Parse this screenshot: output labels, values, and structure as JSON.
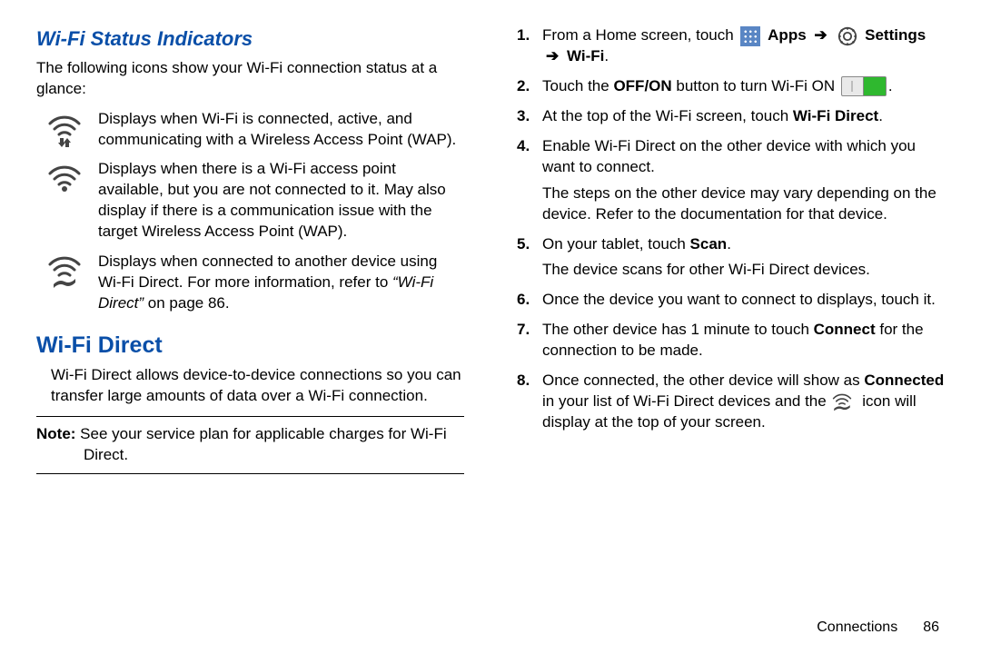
{
  "left": {
    "h_status": "Wi-Fi Status Indicators",
    "status_intro": "The following icons show your Wi-Fi connection status at a glance:",
    "icon1": "Displays when Wi-Fi is connected, active, and communicating with a Wireless Access Point (WAP).",
    "icon2": "Displays when there is a Wi-Fi access point available, but you are not connected to it. May also display if there is a communication issue with the target Wireless Access Point (WAP).",
    "icon3_a": "Displays when connected to another device using Wi-Fi Direct. For more information, refer to ",
    "icon3_ref": "“Wi-Fi Direct”",
    "icon3_b": " on page 86.",
    "h_direct": "Wi-Fi Direct",
    "direct_intro": "Wi-Fi Direct allows device-to-device connections so you can transfer large amounts of data over a Wi-Fi connection.",
    "note_label": "Note:",
    "note_text": " See your service plan for applicable charges for Wi-Fi Direct."
  },
  "right": {
    "s1_a": "From a Home screen, touch ",
    "s1_apps": " Apps ",
    "s1_settings": " Settings ",
    "s1_b": " Wi-Fi",
    "s2_a": "Touch the ",
    "s2_offon": "OFF/ON",
    "s2_b": " button to turn Wi-Fi ON ",
    "s3_a": "At the top of the Wi-Fi screen, touch ",
    "s3_b": "Wi-Fi Direct",
    "s4": "Enable Wi-Fi Direct on the other device with which you want to connect.",
    "s4_p": "The steps on the other device may vary depending on the device. Refer to the documentation for that device.",
    "s5_a": "On your tablet, touch ",
    "s5_b": "Scan",
    "s5_p": "The device scans for other Wi-Fi Direct devices.",
    "s6": "Once the device you want to connect to displays, touch it.",
    "s7_a": "The other device has 1 minute to touch ",
    "s7_b": "Connect",
    "s7_c": " for the connection to be made.",
    "s8_a": "Once connected, the other device will show as ",
    "s8_b": "Connected",
    "s8_c": " in your list of Wi-Fi Direct devices and the ",
    "s8_d": " icon will display at the top of your screen."
  },
  "footer": {
    "section": "Connections",
    "page": "86"
  },
  "labels": {
    "arrow": "➔",
    "period": "."
  }
}
